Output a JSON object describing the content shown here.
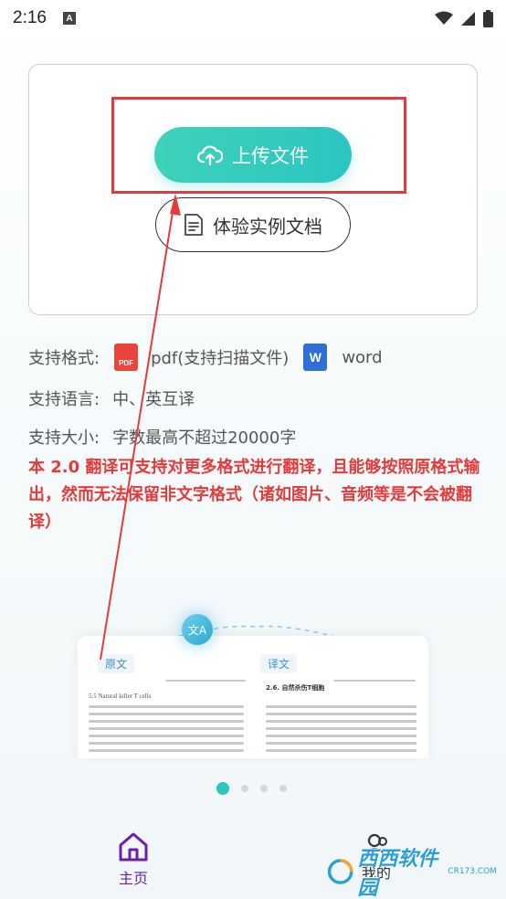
{
  "status_bar": {
    "time": "2:16",
    "notif_icon": "A"
  },
  "upload": {
    "label": "上传文件",
    "icon": "cloud-upload-icon"
  },
  "sample": {
    "label": "体验实例文档",
    "icon": "document-icon"
  },
  "formats": {
    "label": "支持格式:",
    "pdf_badge": "PDF",
    "pdf_label": "pdf(支持扫描文件)",
    "word_badge": "W",
    "word_label": "word"
  },
  "languages": {
    "label": "支持语言:",
    "value": "中、英互译"
  },
  "size": {
    "label": "支持大小:",
    "value": "字数最高不超过20000字"
  },
  "notice": "本 2.0 翻译可支持对更多格式进行翻译，且能够按照原格式输出，然而无法保留非文字格式（诸如图片、音频等是不会被翻译）",
  "preview": {
    "source_tag": "原文",
    "target_tag": "译文",
    "translate_badge": "文A",
    "source_heading": "5.5 Natural killer T cells",
    "target_heading": "2.6. 自然杀伤T细胞"
  },
  "carousel": {
    "count": 4,
    "active": 0
  },
  "tabs": {
    "home": "主页",
    "mine": "我的"
  },
  "watermark": {
    "text": "西西软件园",
    "sub": "CR173.COM"
  },
  "colors": {
    "accent": "#2bc5c2",
    "annotation": "#e23b3b",
    "tab_active": "#6a1fb3"
  }
}
